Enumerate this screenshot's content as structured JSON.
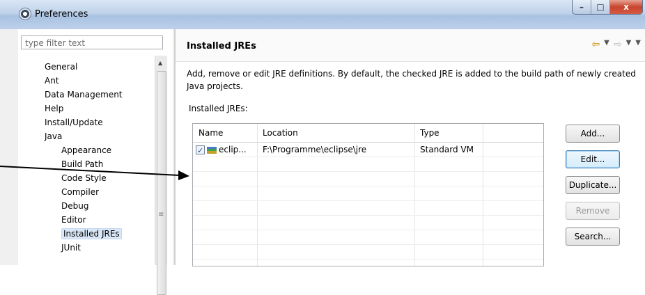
{
  "window": {
    "title": "Preferences",
    "controls": {
      "minimize": "–",
      "maximize": "□",
      "close": "x"
    }
  },
  "filter": {
    "placeholder": "type filter text"
  },
  "tree": {
    "items": [
      {
        "label": "General",
        "level": 0
      },
      {
        "label": "Ant",
        "level": 0
      },
      {
        "label": "Data Management",
        "level": 0
      },
      {
        "label": "Help",
        "level": 0
      },
      {
        "label": "Install/Update",
        "level": 0
      },
      {
        "label": "Java",
        "level": 0
      },
      {
        "label": "Appearance",
        "level": 1
      },
      {
        "label": "Build Path",
        "level": 1
      },
      {
        "label": "Code Style",
        "level": 1
      },
      {
        "label": "Compiler",
        "level": 1
      },
      {
        "label": "Debug",
        "level": 1
      },
      {
        "label": "Editor",
        "level": 1
      },
      {
        "label": "Installed JREs",
        "level": 1,
        "selected": true
      },
      {
        "label": "JUnit",
        "level": 1
      }
    ]
  },
  "page": {
    "title": "Installed JREs",
    "description": "Add, remove or edit JRE definitions. By default, the checked JRE is added to the build path of newly created Java projects.",
    "table_label": "Installed JREs:",
    "columns": [
      "Name",
      "Location",
      "Type"
    ],
    "rows": [
      {
        "checked": true,
        "name": "eclip...",
        "location": "F:\\Programme\\eclipse\\jre",
        "type": "Standard VM"
      }
    ],
    "buttons": {
      "add": "Add...",
      "edit": "Edit...",
      "duplicate": "Duplicate...",
      "remove": "Remove",
      "search": "Search..."
    }
  },
  "colors": {
    "accent": "#3c7fb1",
    "selection": "#d9e7f7",
    "close_button": "#c8452e"
  }
}
